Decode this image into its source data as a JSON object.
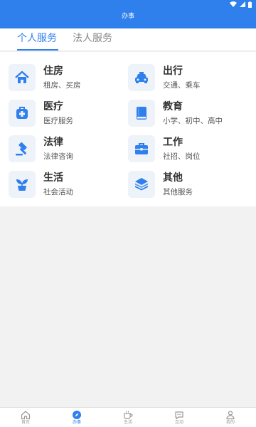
{
  "header": {
    "title": "办事"
  },
  "tabs": [
    {
      "label": "个人服务",
      "active": true
    },
    {
      "label": "法人服务",
      "active": false
    }
  ],
  "services": [
    {
      "title": "住房",
      "subtitle": "租房、买房",
      "icon": "house-icon"
    },
    {
      "title": "出行",
      "subtitle": "交通、乘车",
      "icon": "taxi-icon"
    },
    {
      "title": "医疗",
      "subtitle": "医疗服务",
      "icon": "medical-kit-icon"
    },
    {
      "title": "教育",
      "subtitle": "小学、初中、高中",
      "icon": "book-icon"
    },
    {
      "title": "法律",
      "subtitle": "法律咨询",
      "icon": "gavel-icon"
    },
    {
      "title": "工作",
      "subtitle": "社招、岗位",
      "icon": "briefcase-icon"
    },
    {
      "title": "生活",
      "subtitle": "社会活动",
      "icon": "plant-pot-icon"
    },
    {
      "title": "其他",
      "subtitle": "其他服务",
      "icon": "layers-icon"
    }
  ],
  "bottom_nav": [
    {
      "label": "首页",
      "icon": "home-icon",
      "active": false
    },
    {
      "label": "办事",
      "icon": "compass-icon",
      "active": true
    },
    {
      "label": "生活",
      "icon": "coffee-cup-icon",
      "active": false
    },
    {
      "label": "互动",
      "icon": "chat-icon",
      "active": false
    },
    {
      "label": "我的",
      "icon": "user-icon",
      "active": false
    }
  ],
  "colors": {
    "accent": "#2f80ed",
    "icon_background": "#eef2f9",
    "page_background": "#f2f2f2"
  }
}
